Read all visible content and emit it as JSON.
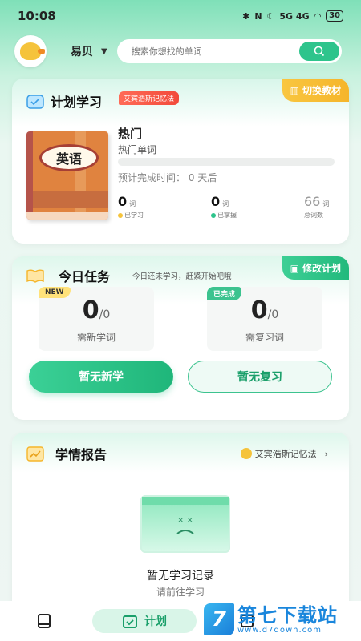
{
  "status": {
    "time": "10:08",
    "battery": "30",
    "network": "5G 4G"
  },
  "header": {
    "username": "易贝",
    "search_placeholder": "搜索你想找的单词"
  },
  "plan": {
    "title": "计划学习",
    "method_tag": "艾宾浩斯记忆法",
    "switch_label": "切换教材",
    "book_cover_text": "英语",
    "book_name": "热门",
    "book_sub": "热门单词",
    "progress": 0,
    "eta": "预计完成时间：  0 天后",
    "stats": [
      {
        "num": "0",
        "unit": "词",
        "label": "已学习",
        "dot": "#f5c33b"
      },
      {
        "num": "0",
        "unit": "词",
        "label": "已掌握",
        "dot": "#2ec48c"
      },
      {
        "num": "66",
        "unit": "词",
        "label": "总词数",
        "dot": ""
      }
    ]
  },
  "task": {
    "title": "今日任务",
    "subtitle": "今日还未学习，赶紧开始吧哦",
    "edit_label": "修改计划",
    "new_box": {
      "badge": "NEW",
      "value": "0",
      "total": "/0",
      "desc": "需新学词"
    },
    "review_box": {
      "badge": "已完成",
      "value": "0",
      "total": "/0",
      "desc": "需复习词"
    },
    "btn_new": "暂无新学",
    "btn_review": "暂无复习"
  },
  "report": {
    "title": "学情报告",
    "method_link": "艾宾浩斯记忆法",
    "empty_title": "暂无学习记录",
    "empty_sub": "请前往学习"
  },
  "tabs": {
    "plan_label": "计划"
  },
  "watermark": {
    "logo": "7",
    "title": "第七下载站",
    "url": "www.d7down.com"
  },
  "colors": {
    "accent": "#2ec48c",
    "tag_red": "#f24a3a",
    "gold": "#f5b52a"
  }
}
